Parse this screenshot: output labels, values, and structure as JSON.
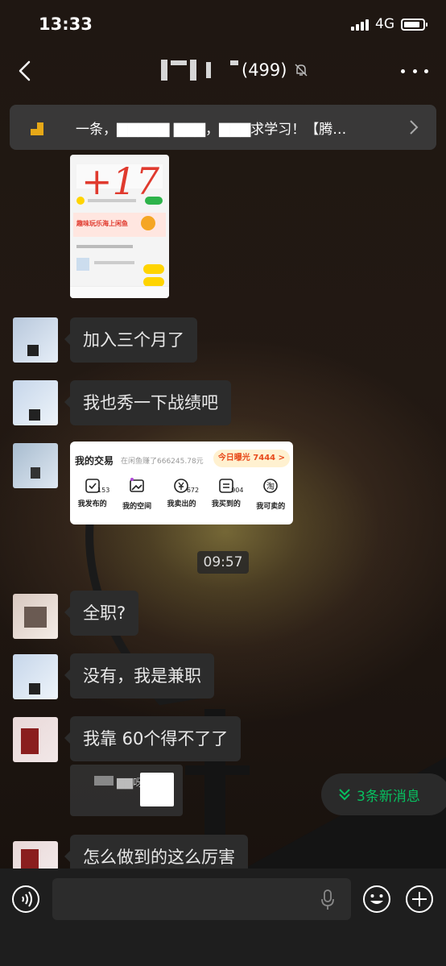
{
  "status": {
    "time": "13:33",
    "network": "4G"
  },
  "chat": {
    "title_count": "(499)"
  },
  "notice": {
    "text": "一条，▇▇▇▇▇ ▇▇▇，▇▇▇求学习！【腾…"
  },
  "messages": [
    {
      "text": "加入三个月了"
    },
    {
      "text": "我也秀一下战绩吧"
    },
    {
      "text": "全职?"
    },
    {
      "text": "没有，我是兼职"
    },
    {
      "text": "我靠 60个得不了了"
    },
    {
      "text": "怎么做到的这么厉害"
    }
  ],
  "card": {
    "title": "我的交易",
    "subtitle": "在闲鱼赚了666245.78元",
    "badge": "今日曝光 7444 >",
    "items": [
      {
        "label": "我发布的",
        "count": "153"
      },
      {
        "label": "我的空间",
        "count": ""
      },
      {
        "label": "我卖出的",
        "count": "672"
      },
      {
        "label": "我买到的",
        "count": "904"
      },
      {
        "label": "我可卖的",
        "count": ""
      }
    ]
  },
  "screenshot": {
    "big_number": "+17",
    "banner": "趣味玩乐海上闲鱼"
  },
  "timestamp": "09:57",
  "quote": {
    "name": "▇▇呀:"
  },
  "new_messages": "3条新消息",
  "input": {
    "placeholder": ""
  }
}
